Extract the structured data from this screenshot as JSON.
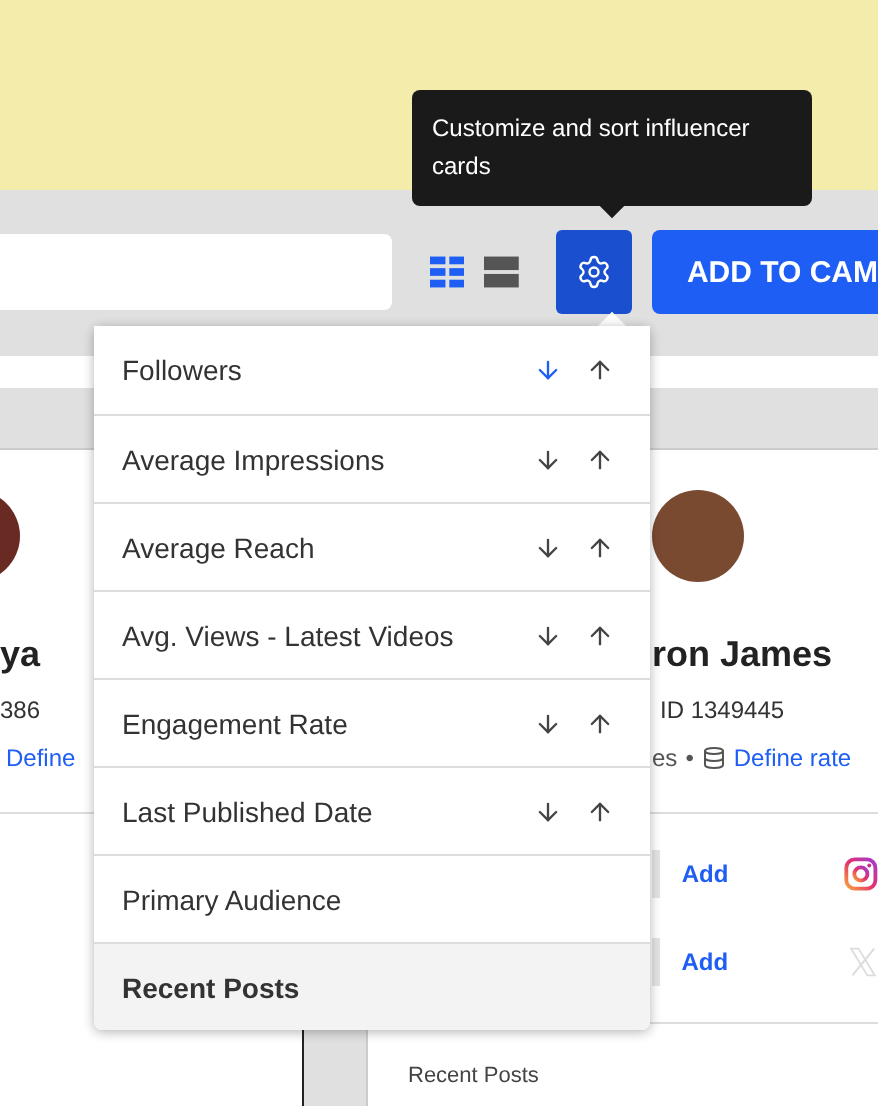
{
  "tooltip": {
    "text": "Customize and sort influencer cards"
  },
  "toolbar": {
    "view_modes": [
      {
        "kind": "grid",
        "selected": true
      },
      {
        "kind": "list",
        "selected": false
      }
    ],
    "primary_button": "ADD TO CAM"
  },
  "sort_menu": {
    "items": [
      {
        "label": "Followers",
        "kind": "sortable",
        "descending_active": true,
        "selected": false
      },
      {
        "label": "Average Impressions",
        "kind": "sortable",
        "descending_active": false,
        "selected": false
      },
      {
        "label": "Average Reach",
        "kind": "sortable",
        "descending_active": false,
        "selected": false
      },
      {
        "label": "Avg. Views - Latest Videos",
        "kind": "sortable",
        "descending_active": false,
        "selected": false
      },
      {
        "label": "Engagement Rate",
        "kind": "sortable",
        "descending_active": false,
        "selected": false
      },
      {
        "label": "Last Published Date",
        "kind": "sortable",
        "descending_active": false,
        "selected": false
      },
      {
        "label": "Primary Audience",
        "kind": "plain",
        "selected": false
      },
      {
        "label": "Recent Posts",
        "kind": "plain",
        "selected": true
      }
    ]
  },
  "cards": [
    {
      "name": "ya",
      "id": "386",
      "rate_link": "Define"
    },
    {
      "name": "ron James",
      "id": "ID 1349445",
      "meta": "es",
      "separator": "•",
      "rate_link": "Define rate",
      "socials": [
        {
          "kind": "instagram",
          "action": "Add"
        },
        {
          "kind": "x",
          "action": "Add"
        }
      ],
      "section": "Recent Posts"
    }
  ]
}
